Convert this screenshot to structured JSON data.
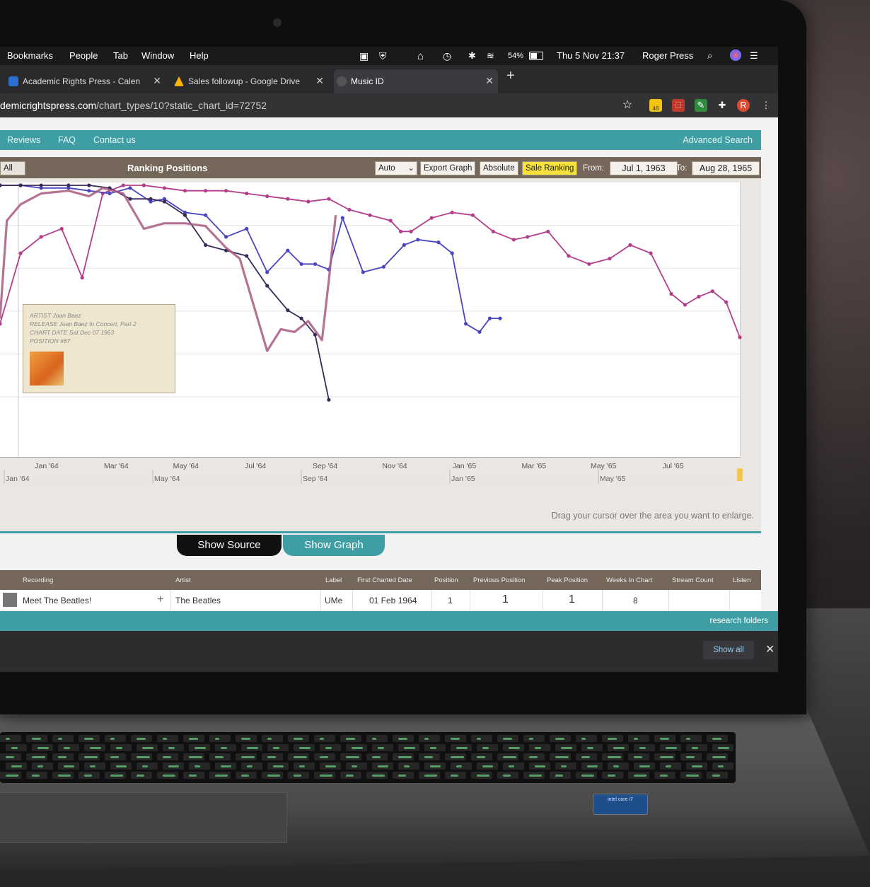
{
  "menubar": {
    "items": [
      "Bookmarks",
      "People",
      "Tab",
      "Window",
      "Help"
    ],
    "battery": "54%",
    "clock": "Thu 5 Nov  21:37",
    "user": "Roger Press"
  },
  "tabs": [
    {
      "title": "Academic Rights Press - Calen",
      "favicon_color": "#2d6fd1"
    },
    {
      "title": "Sales followup - Google Drive",
      "favicon_color": "#f4b400"
    },
    {
      "title": "Music ID",
      "favicon_color": "#777777",
      "active": true
    }
  ],
  "address": {
    "host": "demicrightspress.com",
    "path": "/chart_types/10?static_chart_id=72752",
    "ext_badge": "46",
    "profile_initial": "R"
  },
  "sitenav": {
    "items": [
      "Reviews",
      "FAQ",
      "Contact us"
    ],
    "advanced_search": "Advanced Search"
  },
  "chart_toolbar": {
    "all_button": "All",
    "title": "Ranking Positions",
    "scale_select": "Auto",
    "export": "Export Graph",
    "absolute": "Absolute",
    "sale_ranking": "Sale Ranking",
    "from_label": "From:",
    "from_value": "Jul 1, 1963",
    "to_label": "To:",
    "to_value": "Aug 28, 1965",
    "highlight_color": "#f6e23a"
  },
  "tooltip": {
    "artist_label": "ARTIST",
    "artist": "Joan Baez",
    "release_label": "RELEASE",
    "release": "Joan Baez In Concert, Part 2",
    "chart_date_label": "CHART DATE",
    "chart_date": "Sat Dec 07 1963",
    "position_label": "POSITION",
    "position": "#87"
  },
  "chart_data": {
    "type": "line",
    "title": "Ranking Positions",
    "x_ticks": [
      "Jan '64",
      "Mar '64",
      "May '64",
      "Jul '64",
      "Sep '64",
      "Nov '64",
      "Jan '65",
      "Mar '65",
      "May '65",
      "Jul '65"
    ],
    "navigator_ticks": [
      "Jan '64",
      "May '64",
      "Sep '64",
      "Jan '65",
      "May '65"
    ],
    "x_range": [
      1963.5,
      1965.66
    ],
    "y_inverted": true,
    "y_range": [
      1,
      100
    ],
    "grid": true,
    "series": [
      {
        "color": "#b23d8a",
        "markers": true,
        "x": [
          1963.5,
          1963.56,
          1963.62,
          1963.68,
          1963.74,
          1963.8,
          1963.86,
          1963.92,
          1963.98,
          1964.04,
          1964.1,
          1964.16,
          1964.22,
          1964.28,
          1964.34,
          1964.4,
          1964.46,
          1964.52,
          1964.58,
          1964.64,
          1964.67,
          1964.7,
          1964.76,
          1964.82,
          1964.88,
          1964.94,
          1965.0,
          1965.04,
          1965.1,
          1965.16,
          1965.22,
          1965.28,
          1965.34,
          1965.4,
          1965.46,
          1965.5,
          1965.54,
          1965.58,
          1965.62,
          1965.66
        ],
        "y": [
          52,
          26,
          20,
          17,
          35,
          4,
          1,
          1,
          2,
          3,
          3,
          3,
          4,
          5,
          6,
          7,
          6,
          10,
          12,
          14,
          18,
          18,
          13,
          11,
          12,
          18,
          21,
          20,
          18,
          27,
          30,
          28,
          23,
          26,
          41,
          45,
          42,
          40,
          44,
          57
        ]
      },
      {
        "color": "#4a46c0",
        "markers": true,
        "x": [
          1963.5,
          1963.56,
          1963.62,
          1963.7,
          1963.76,
          1963.82,
          1963.88,
          1963.94,
          1963.98,
          1964.04,
          1964.1,
          1964.16,
          1964.22,
          1964.28,
          1964.34,
          1964.38,
          1964.42,
          1964.46,
          1964.5,
          1964.56,
          1964.62,
          1964.68,
          1964.72,
          1964.78,
          1964.82,
          1964.86,
          1964.9,
          1964.93,
          1964.96
        ],
        "y": [
          1,
          1,
          2,
          2,
          3,
          4,
          2,
          7,
          6,
          11,
          12,
          20,
          17,
          33,
          25,
          30,
          30,
          32,
          13,
          33,
          31,
          23,
          21,
          22,
          26,
          52,
          55,
          50,
          50
        ]
      },
      {
        "color": "#3a2a5a",
        "markers": true,
        "x": [
          1963.5,
          1963.56,
          1963.62,
          1963.7,
          1963.76,
          1963.82,
          1963.88,
          1963.94,
          1963.98,
          1964.04,
          1964.1,
          1964.16,
          1964.22,
          1964.28,
          1964.34,
          1964.38,
          1964.42,
          1964.46
        ],
        "y": [
          1,
          1,
          1,
          1,
          1,
          2,
          6,
          6,
          7,
          12,
          23,
          25,
          27,
          38,
          47,
          50,
          56,
          80
        ]
      },
      {
        "color": "#a85a80",
        "markers": false,
        "x": [
          1963.5,
          1963.52,
          1963.56,
          1963.62,
          1963.7,
          1963.76,
          1963.8,
          1963.86,
          1963.92,
          1963.98,
          1964.04,
          1964.1,
          1964.16,
          1964.2,
          1964.24,
          1964.28,
          1964.32,
          1964.36,
          1964.4,
          1964.44,
          1964.46,
          1964.48
        ],
        "y": [
          50,
          14,
          8,
          4,
          3,
          5,
          2,
          4,
          17,
          15,
          15,
          16,
          24,
          28,
          45,
          62,
          54,
          55,
          51,
          58,
          36,
          12
        ]
      }
    ]
  },
  "navigator_hint": "Drag your cursor over the area you want to enlarge.",
  "view_toggle": {
    "show_source": "Show Source",
    "show_graph": "Show Graph"
  },
  "table": {
    "headers": [
      "Recording",
      "Artist",
      "Label",
      "First Charted Date",
      "Position",
      "Previous Position",
      "Peak Position",
      "Weeks In Chart",
      "Stream Count",
      "Listen"
    ],
    "rows": [
      {
        "recording": "Meet The Beatles!",
        "add": "+",
        "artist": "The Beatles",
        "label": "UMe",
        "first_charted": "01 Feb 1964",
        "position": "1",
        "previous_position": "1",
        "peak_position": "1",
        "weeks_in_chart": "8",
        "stream_count": "",
        "listen": ""
      }
    ]
  },
  "folders_bar": {
    "label": "research folders"
  },
  "download_bar": {
    "show_all": "Show all",
    "close": "✕"
  },
  "sticker": {
    "text": "intel core i7"
  }
}
